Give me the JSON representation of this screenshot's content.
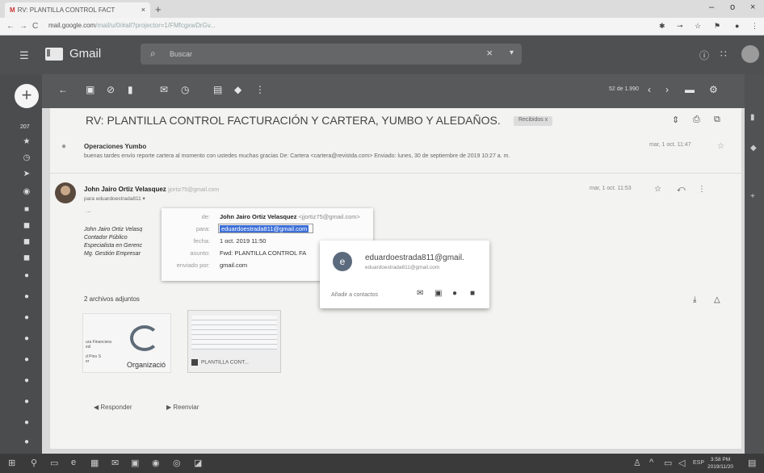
{
  "browser": {
    "tab_title": "RV: PLANTILLA CONTROL FACT",
    "tab_close": "×",
    "new_tab": "+",
    "minimize": "–",
    "maximize": "o",
    "close": "×",
    "url_host": "mail.google.com",
    "url_path": "/mail/u/0/#all?projector=1/FMfcgxwDrGv...",
    "back": "←",
    "forward": "→",
    "reload": "C"
  },
  "gmail": {
    "brand": "Gmail",
    "search_placeholder": "Buscar",
    "search_clear": "×",
    "search_options": "▾",
    "help_icon": "?",
    "apps_icon": "⋮⋮⋮"
  },
  "rail": {
    "compose": "+",
    "inbox_count": "207"
  },
  "toolbar": {
    "pagination": "52 de 1.990",
    "prev": "‹",
    "next": "›"
  },
  "message": {
    "subject": "RV: PLANTILLA CONTROL FACTURACIÓN Y CARTERA, YUMBO Y ALEDAÑOS.",
    "label": "Recibidos x",
    "first": {
      "sender": "Operaciones Yumbo",
      "snippet": "buenas tardes envío reporte cartera al momento con ustedes muchas gracias De: Cartera <cartera@revistda.com> Enviado: lunes, 30 de septiembre de 2019 10:27 a. m.",
      "date": "mar, 1 oct. 11:47"
    },
    "second": {
      "sender": "John Jairo Ortiz Velasquez",
      "sender_email": "jjortiz75@gmail.com",
      "to": "para eduardoestrada811 ▾",
      "date": "mar, 1 oct. 11:53",
      "ellipsis": "...",
      "signature": [
        "John Jairo Ortiz Velasq",
        "Contador Público",
        "Especialista en Gerenc",
        "Mg. Gestión Empresar"
      ]
    },
    "details": {
      "from_label": "de:",
      "from_name": "John Jairo Ortiz Velasquez",
      "from_email": "<jjortiz75@gmail.com>",
      "to_label": "para:",
      "to_value": "eduardoestrada811@gmail.com",
      "date_label": "fecha:",
      "date_value": "1 oct. 2019 11:50",
      "subject_label": "asunto:",
      "subject_value": "Fwd: PLANTILLA CONTROL FA",
      "mailed_label": "enviado por:",
      "mailed_value": "gmail.com"
    },
    "hovercard": {
      "initial": "e",
      "name": "eduardoestrada811@gmail.",
      "email": "eduardoestrada811@gmail.com",
      "add_contacts": "Añadir a contactos"
    },
    "attachments": {
      "title": "2 archivos adjuntos",
      "first_text": "ura Financiera\nesl\n\nd Pino S\ner",
      "first_org": "Organizació",
      "second_name": "PLANTILLA CONT..."
    },
    "reply": "Responder",
    "forward": "Reenviar"
  },
  "taskbar": {
    "time": "3:58 PM",
    "date": "2019/11/20",
    "lang": "ESP"
  }
}
